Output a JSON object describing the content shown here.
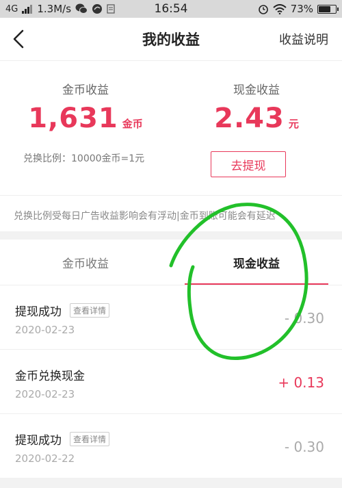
{
  "status_bar": {
    "network": "4G",
    "speed": "1.3M/s",
    "time": "16:54",
    "battery": "73%",
    "battery_level": 0.73
  },
  "nav": {
    "title": "我的收益",
    "action": "收益说明",
    "back_icon": "chevron-left-icon"
  },
  "summary": {
    "coin_label": "金币收益",
    "coin_amount": "1,631",
    "coin_unit": "金币",
    "cash_label": "现金收益",
    "cash_amount": "2.43",
    "cash_unit": "元",
    "rate_text": "兑换比例：10000金币=1元",
    "withdraw_label": "去提现",
    "notice": "兑换比例受每日广告收益影响会有浮动|金币到账可能会有延迟"
  },
  "tabs": [
    {
      "label": "金币收益",
      "active": false
    },
    {
      "label": "现金收益",
      "active": true
    }
  ],
  "records": [
    {
      "title": "提现成功",
      "tag": "查看详情",
      "date": "2020-02-23",
      "amount": "- 0.30"
    },
    {
      "title": "金币兑换现金",
      "tag": "",
      "date": "2020-02-23",
      "amount": "+ 0.13"
    },
    {
      "title": "提现成功",
      "tag": "查看详情",
      "date": "2020-02-22",
      "amount": "- 0.30"
    }
  ],
  "colors": {
    "accent": "#e8385a",
    "scribble": "#22c02a"
  }
}
